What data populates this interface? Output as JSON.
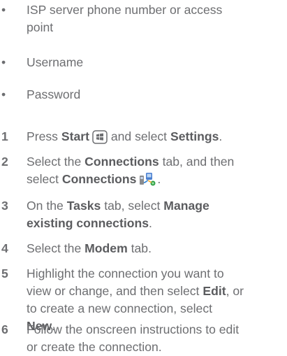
{
  "bullets": [
    {
      "line1": "ISP server phone number or access",
      "line2": "point"
    },
    {
      "line1": "Username"
    },
    {
      "line1": "Password"
    }
  ],
  "steps": [
    {
      "number": "1",
      "parts": [
        "Press ",
        "Start",
        " and select ",
        "Settings",
        "."
      ]
    },
    {
      "number": "2",
      "line1": [
        "Select the ",
        "Connections",
        " tab, and then"
      ],
      "line2": [
        "select ",
        "Connections",
        "."
      ]
    },
    {
      "number": "3",
      "line1": [
        "On the ",
        "Tasks",
        " tab, select ",
        "Manage"
      ],
      "line2": [
        "existing connections",
        "."
      ]
    },
    {
      "number": "4",
      "parts": [
        "Select the ",
        "Modem",
        " tab."
      ]
    },
    {
      "number": "5",
      "line1": "Highlight the connection you want to",
      "line2": [
        "view or change, and then select ",
        "Edit",
        ", or"
      ],
      "line3": "to create a new connection, select",
      "line4": [
        "New",
        "."
      ]
    },
    {
      "number": "6",
      "line1": "Follow the onscreen instructions to edit",
      "line2": "or create the connection."
    }
  ],
  "icons": {
    "start": "windows-start-icon",
    "connections": "connections-icon"
  },
  "colors": {
    "text": "#6d6e71",
    "bold": "#5b5c5f"
  }
}
